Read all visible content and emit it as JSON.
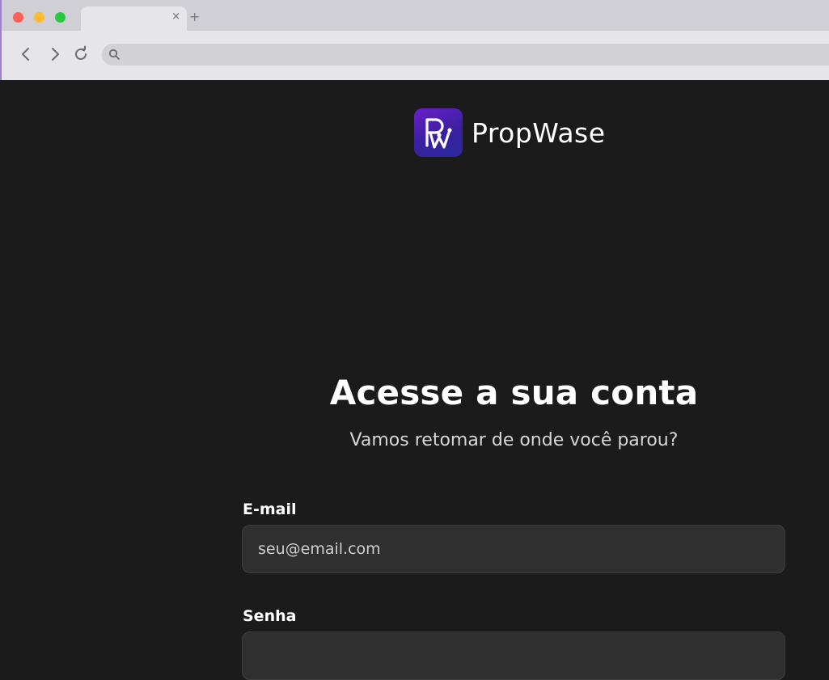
{
  "browser": {
    "tab_title": "",
    "tab_close": "×",
    "new_tab": "+",
    "address_value": "",
    "colors": {
      "close": "#fe5f57",
      "minimize": "#febc2e",
      "maximize": "#28c840"
    }
  },
  "brand": {
    "name": "PropWase",
    "logo_icon": "propwase-logo-icon",
    "colors": {
      "logo_start": "#6a1fc9",
      "logo_end": "#2a2a9a"
    }
  },
  "login": {
    "title": "Acesse a sua conta",
    "subtitle": "Vamos retomar de onde você parou?",
    "email_label": "E-mail",
    "email_placeholder": "seu@email.com",
    "email_value": "",
    "password_label": "Senha",
    "password_placeholder": "",
    "password_value": ""
  },
  "theme": {
    "background": "#1b1b1b",
    "input_background": "#2f2f2f",
    "text": "#ffffff"
  }
}
